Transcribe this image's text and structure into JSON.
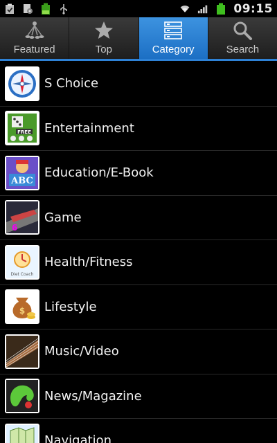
{
  "status_bar": {
    "time": "09:15",
    "left_icons": [
      "clipboard-check-icon",
      "settings-doc-icon",
      "battery-100-notification-icon",
      "usb-icon"
    ],
    "right_icons": [
      "wifi-icon",
      "signal-icon",
      "battery-icon"
    ]
  },
  "tabs": [
    {
      "label": "Featured",
      "icon": "featured-icon",
      "active": false
    },
    {
      "label": "Top",
      "icon": "star-icon",
      "active": false
    },
    {
      "label": "Category",
      "icon": "category-list-icon",
      "active": true
    },
    {
      "label": "Search",
      "icon": "search-icon",
      "active": false
    }
  ],
  "categories": [
    {
      "label": "S Choice",
      "icon": "compass-icon"
    },
    {
      "label": "Entertainment",
      "icon": "dice-free-icon"
    },
    {
      "label": "Education/E-Book",
      "icon": "abc-blocks-icon"
    },
    {
      "label": "Game",
      "icon": "racing-game-icon"
    },
    {
      "label": "Health/Fitness",
      "icon": "diet-coach-icon"
    },
    {
      "label": "Lifestyle",
      "icon": "money-bag-icon"
    },
    {
      "label": "Music/Video",
      "icon": "guitar-icon"
    },
    {
      "label": "News/Magazine",
      "icon": "green-blob-icon"
    },
    {
      "label": "Navigation",
      "icon": "map-icon"
    }
  ],
  "colors": {
    "accent": "#2e82d6",
    "active_tab": "#2a82d6",
    "background": "#000000"
  }
}
